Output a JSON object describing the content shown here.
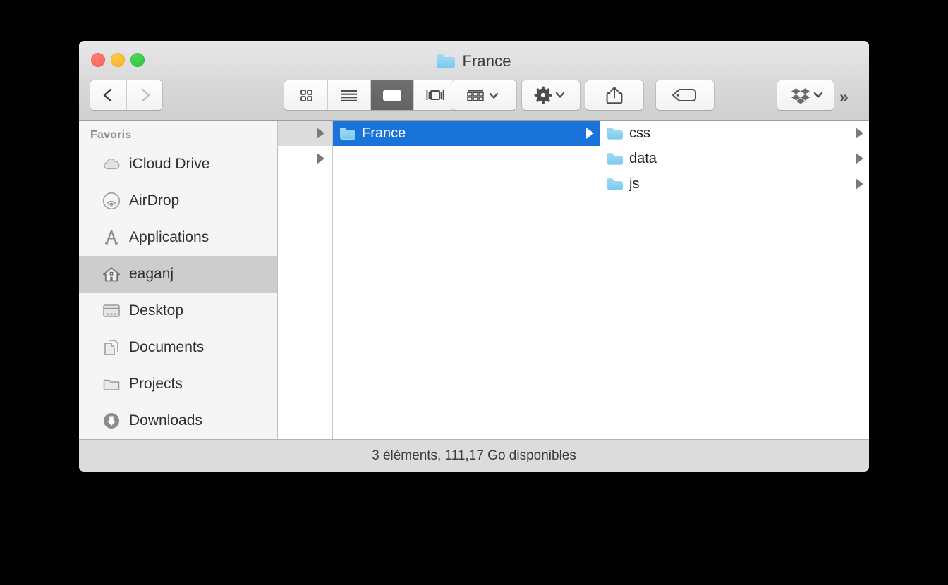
{
  "window": {
    "title": "France",
    "title_icon": "folder-icon",
    "traffic_lights": [
      {
        "name": "close-button",
        "color": "#f9625a"
      },
      {
        "name": "minimize-button",
        "color": "#f6b01e"
      },
      {
        "name": "maximize-button",
        "color": "#2ac33a"
      }
    ]
  },
  "toolbar": {
    "back_icon": "chevron-left-icon",
    "forward_icon": "chevron-right-icon",
    "view_modes": [
      {
        "name": "icon-view-button",
        "icon": "grid-icon",
        "active": false
      },
      {
        "name": "list-view-button",
        "icon": "list-icon",
        "active": false
      },
      {
        "name": "column-view-button",
        "icon": "columns-icon",
        "active": true
      },
      {
        "name": "gallery-view-button",
        "icon": "gallery-icon",
        "active": false
      }
    ],
    "arrange_icon": "arrange-grid-icon",
    "action_icon": "gear-icon",
    "share_icon": "share-icon",
    "tag_icon": "tag-icon",
    "dropbox_icon": "dropbox-icon",
    "dropdown_icon": "chevron-down-icon",
    "overflow_label": "»"
  },
  "sidebar": {
    "header": "Favoris",
    "items": [
      {
        "label": "iCloud Drive",
        "icon": "cloud-icon",
        "selected": false
      },
      {
        "label": "AirDrop",
        "icon": "airdrop-icon",
        "selected": false
      },
      {
        "label": "Applications",
        "icon": "compass-icon",
        "selected": false
      },
      {
        "label": "eaganj",
        "icon": "home-icon",
        "selected": true
      },
      {
        "label": "Desktop",
        "icon": "desktop-icon",
        "selected": false
      },
      {
        "label": "Documents",
        "icon": "documents-icon",
        "selected": false
      },
      {
        "label": "Projects",
        "icon": "folder-icon",
        "selected": false
      },
      {
        "label": "Downloads",
        "icon": "download-icon",
        "selected": false
      }
    ]
  },
  "columns": {
    "column1": {
      "rows": [
        {
          "label": "",
          "selected": "gray",
          "disclosure": true
        },
        {
          "label": "",
          "selected": "none",
          "disclosure": true
        }
      ]
    },
    "column2": {
      "rows": [
        {
          "label": "France",
          "icon": "folder-icon",
          "selected": "blue",
          "disclosure": true
        }
      ]
    },
    "column3": {
      "rows": [
        {
          "label": "css",
          "icon": "folder-icon",
          "selected": "none",
          "disclosure": true
        },
        {
          "label": "data",
          "icon": "folder-icon",
          "selected": "none",
          "disclosure": true
        },
        {
          "label": "js",
          "icon": "folder-icon",
          "selected": "none",
          "disclosure": true
        }
      ]
    }
  },
  "statusbar": {
    "text": "3 éléments, 111,17 Go disponibles"
  },
  "colors": {
    "selection_blue": "#1a73d8",
    "selection_gray": "#cdcdcd",
    "folder_blue": "#78c8ef",
    "toolbar_bg": "#d8d8d8",
    "sidebar_bg": "#f5f5f5",
    "statusbar_bg": "#dcdcdc"
  }
}
